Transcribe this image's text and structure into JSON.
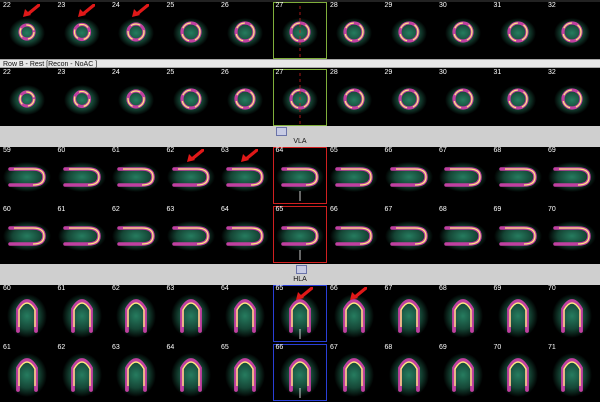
{
  "rows": [
    {
      "id": "sa-stress",
      "numbers": [
        "22",
        "23",
        "24",
        "25",
        "26",
        "27",
        "28",
        "29",
        "30",
        "31",
        "32"
      ],
      "view": "sa",
      "selected": 5,
      "sel_color": "green"
    },
    {
      "id": "sa-rest",
      "numbers": [
        "22",
        "23",
        "24",
        "25",
        "26",
        "27",
        "28",
        "29",
        "30",
        "31",
        "32"
      ],
      "view": "sa2",
      "selected": 5,
      "sel_color": "green"
    },
    {
      "id": "vla-stress",
      "numbers": [
        "59",
        "60",
        "61",
        "62",
        "63",
        "64",
        "65",
        "66",
        "67",
        "68",
        "69"
      ],
      "view": "vla",
      "selected": 5,
      "sel_color": "red"
    },
    {
      "id": "vla-rest",
      "numbers": [
        "60",
        "61",
        "62",
        "63",
        "64",
        "65",
        "66",
        "67",
        "68",
        "69",
        "70"
      ],
      "view": "vla",
      "selected": 5,
      "sel_color": "red"
    },
    {
      "id": "hla-stress",
      "numbers": [
        "60",
        "61",
        "62",
        "63",
        "64",
        "65",
        "66",
        "67",
        "68",
        "69",
        "70"
      ],
      "view": "hla",
      "selected": 5,
      "sel_color": "blue"
    },
    {
      "id": "hla-rest",
      "numbers": [
        "61",
        "62",
        "63",
        "64",
        "65",
        "66",
        "67",
        "68",
        "69",
        "70",
        "71"
      ],
      "view": "hla",
      "selected": 5,
      "sel_color": "blue"
    }
  ],
  "row_b_label": "Row B - Rest [Recon - NoAC ]",
  "sections": {
    "vla_title": "VLA",
    "hla_title": "HLA"
  },
  "arrows": [
    {
      "row": 0,
      "col": 0,
      "name": "arrow-sa-22"
    },
    {
      "row": 0,
      "col": 1,
      "name": "arrow-sa-23"
    },
    {
      "row": 0,
      "col": 2,
      "name": "arrow-sa-24"
    },
    {
      "row": 2,
      "col": 3,
      "name": "arrow-vla-62"
    },
    {
      "row": 2,
      "col": 4,
      "name": "arrow-vla-63"
    },
    {
      "row": 4,
      "col": 5,
      "name": "arrow-hla-65"
    },
    {
      "row": 4,
      "col": 6,
      "name": "arrow-hla-66"
    }
  ],
  "colors": {
    "background": "#000000",
    "panel": "#d4d4d4",
    "hot": "#ffe680",
    "mid": "#c040a0",
    "cool": "#2a8a6a",
    "arrow": "#e01818"
  }
}
